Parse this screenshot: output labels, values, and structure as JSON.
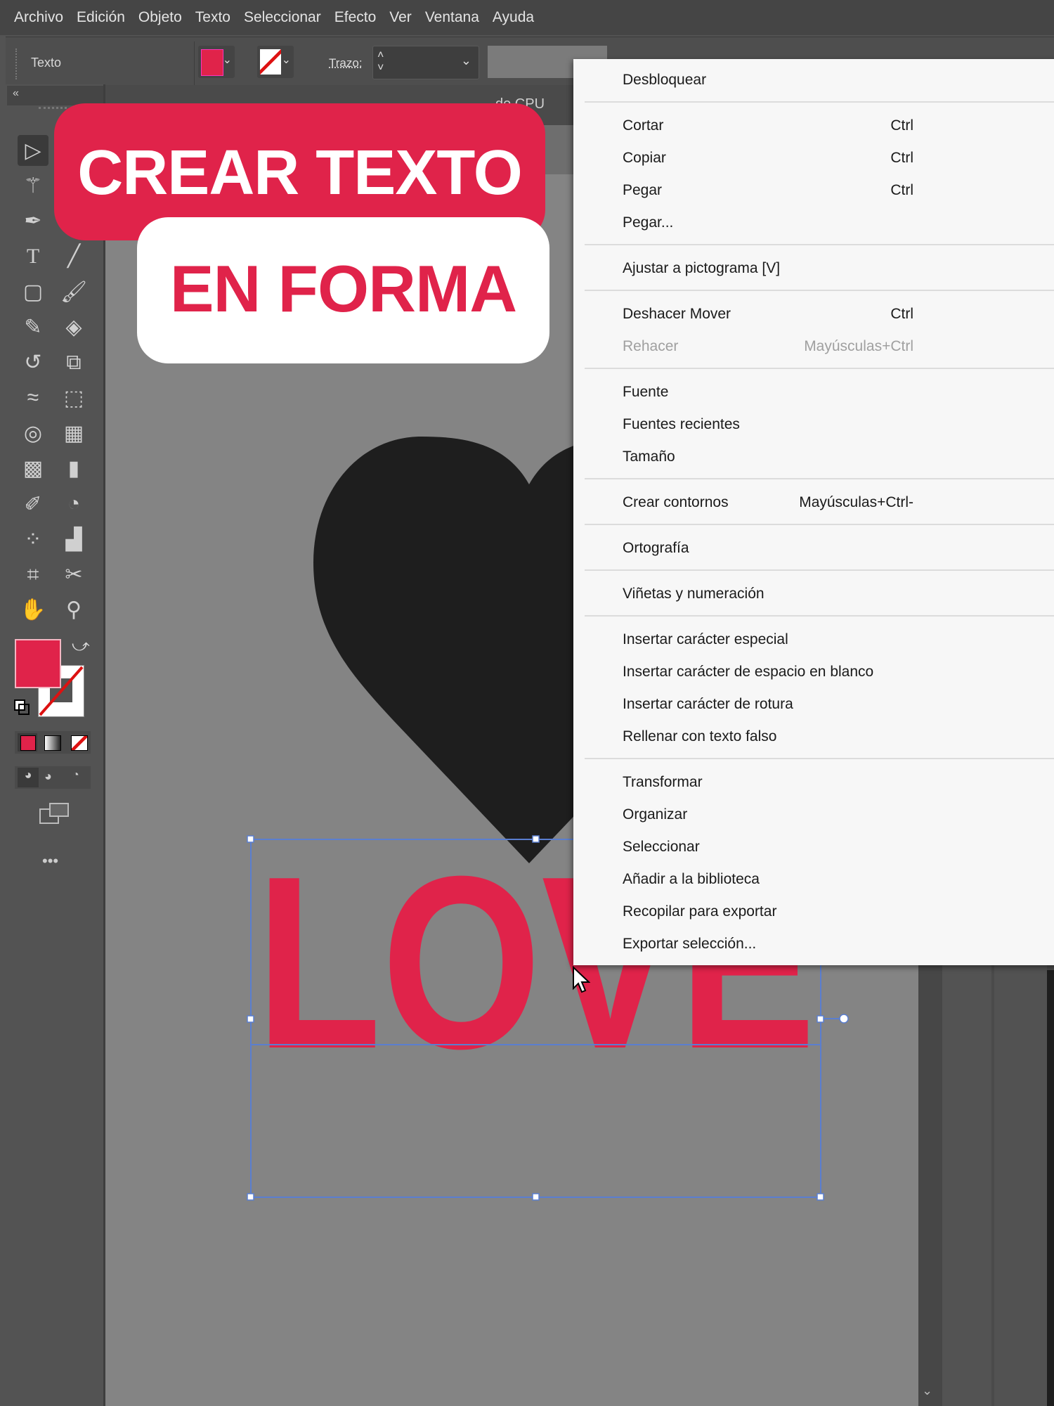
{
  "menubar": [
    "Archivo",
    "Edición",
    "Objeto",
    "Texto",
    "Seleccionar",
    "Efecto",
    "Ver",
    "Ventana",
    "Ayuda"
  ],
  "controlbar": {
    "label": "Texto",
    "stroke_label": "Trazo:",
    "fill_color": "#e0234a"
  },
  "document_tab": {
    "title_visible": "de CPU"
  },
  "overlay": {
    "line1": "CREAR TEXTO",
    "line2": "EN FORMA"
  },
  "artwork": {
    "text": "LOVE",
    "text_color": "#e0234a",
    "heart_color": "#1e1e1e"
  },
  "tools": [
    [
      "selection-tool-icon",
      null
    ],
    [
      "magic-wand-tool-icon",
      null
    ],
    [
      "pen-tool-icon",
      null
    ],
    [
      "type-tool-icon",
      "line-segment-tool-icon"
    ],
    [
      "rectangle-tool-icon",
      "paintbrush-tool-icon"
    ],
    [
      "shaper-tool-icon",
      "eraser-tool-icon"
    ],
    [
      "rotate-tool-icon",
      "scale-tool-icon"
    ],
    [
      "width-tool-icon",
      "free-transform-tool-icon"
    ],
    [
      "shape-builder-tool-icon",
      "perspective-grid-tool-icon"
    ],
    [
      "mesh-tool-icon",
      "gradient-tool-icon"
    ],
    [
      "eyedropper-tool-icon",
      "blend-tool-icon"
    ],
    [
      "symbol-sprayer-tool-icon",
      "column-graph-tool-icon"
    ],
    [
      "artboard-tool-icon",
      "slice-tool-icon"
    ],
    [
      "hand-tool-icon",
      "zoom-tool-icon"
    ]
  ],
  "context_menu": [
    {
      "label": "Desbloquear"
    },
    {
      "sep": true
    },
    {
      "label": "Cortar",
      "shortcut": "Ctrl"
    },
    {
      "label": "Copiar",
      "shortcut": "Ctrl"
    },
    {
      "label": "Pegar",
      "shortcut": "Ctrl"
    },
    {
      "label": "Pegar..."
    },
    {
      "sep": true
    },
    {
      "label": "Ajustar a pictograma [V]"
    },
    {
      "sep": true
    },
    {
      "label": "Deshacer Mover",
      "shortcut": "Ctrl"
    },
    {
      "label": "Rehacer",
      "shortcut": "Mayúsculas+Ctrl",
      "disabled": true
    },
    {
      "sep": true
    },
    {
      "label": "Fuente"
    },
    {
      "label": "Fuentes recientes"
    },
    {
      "label": "Tamaño"
    },
    {
      "sep": true
    },
    {
      "label": "Crear contornos",
      "shortcut": "Mayúsculas+Ctrl-"
    },
    {
      "sep": true
    },
    {
      "label": "Ortografía"
    },
    {
      "sep": true
    },
    {
      "label": "Viñetas y numeración"
    },
    {
      "sep": true
    },
    {
      "label": "Insertar carácter especial"
    },
    {
      "label": "Insertar carácter de espacio en blanco"
    },
    {
      "label": "Insertar carácter de rotura"
    },
    {
      "label": "Rellenar con texto falso"
    },
    {
      "sep": true
    },
    {
      "label": "Transformar"
    },
    {
      "label": "Organizar"
    },
    {
      "label": "Seleccionar"
    },
    {
      "label": "Añadir a la biblioteca"
    },
    {
      "label": "Recopilar para exportar"
    },
    {
      "label": "Exportar selección..."
    }
  ]
}
